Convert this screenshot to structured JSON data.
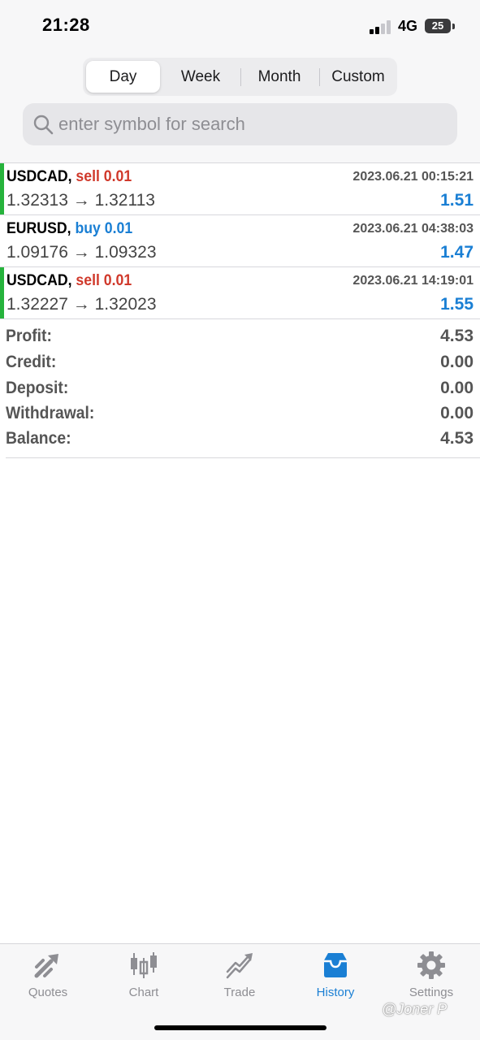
{
  "status_bar": {
    "time": "21:28",
    "network": "4G",
    "battery": "25"
  },
  "period_tabs": [
    {
      "label": "Day",
      "active": true
    },
    {
      "label": "Week",
      "active": false
    },
    {
      "label": "Month",
      "active": false
    },
    {
      "label": "Custom",
      "active": false
    }
  ],
  "search": {
    "placeholder": "enter symbol for search",
    "value": ""
  },
  "deals": [
    {
      "symbol": "USDCAD,",
      "type": "sell 0.01",
      "side": "sell",
      "time": "2023.06.21 00:15:21",
      "open": "1.32313",
      "close": "1.32113",
      "profit": "1.51"
    },
    {
      "symbol": "EURUSD,",
      "type": "buy 0.01",
      "side": "buy",
      "time": "2023.06.21 04:38:03",
      "open": "1.09176",
      "close": "1.09323",
      "profit": "1.47"
    },
    {
      "symbol": "USDCAD,",
      "type": "sell 0.01",
      "side": "sell",
      "time": "2023.06.21 14:19:01",
      "open": "1.32227",
      "close": "1.32023",
      "profit": "1.55"
    }
  ],
  "arrow": "→",
  "summary": [
    {
      "label": "Profit:",
      "value": "4.53"
    },
    {
      "label": "Credit:",
      "value": "0.00"
    },
    {
      "label": "Deposit:",
      "value": "0.00"
    },
    {
      "label": "Withdrawal:",
      "value": "0.00"
    },
    {
      "label": "Balance:",
      "value": "4.53"
    }
  ],
  "tab_bar": [
    {
      "label": "Quotes",
      "icon": "quotes-icon",
      "active": false
    },
    {
      "label": "Chart",
      "icon": "chart-icon",
      "active": false
    },
    {
      "label": "Trade",
      "icon": "trade-icon",
      "active": false
    },
    {
      "label": "History",
      "icon": "history-icon",
      "active": true
    },
    {
      "label": "Settings",
      "icon": "gear-icon",
      "active": false
    }
  ],
  "watermark": "@Joner P",
  "colors": {
    "sell": "#d0392b",
    "buy": "#1a7fd4",
    "profit": "#1a7fd4",
    "deal_bar": "#26b33c",
    "tab_active": "#1a7fd4",
    "tab_inactive": "#8e8e93"
  }
}
